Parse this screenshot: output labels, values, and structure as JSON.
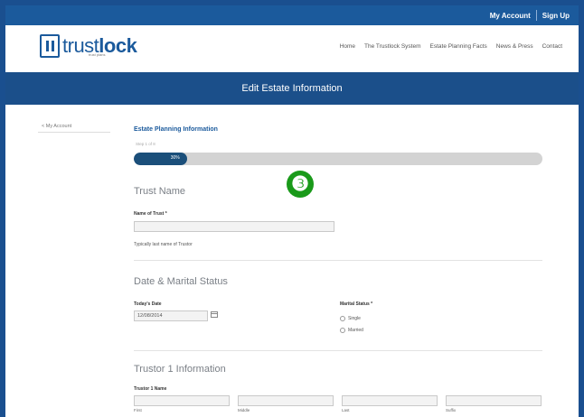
{
  "top_links": {
    "my_account": "My Account",
    "sign_up": "Sign Up"
  },
  "logo": {
    "brand_light": "trust",
    "brand_bold": "lock",
    "tagline": "trust plans"
  },
  "nav": [
    "Home",
    "The Trustlock System",
    "Estate Planning Facts",
    "News & Press",
    "Contact"
  ],
  "banner": {
    "title": "Edit Estate Information"
  },
  "sidebar": {
    "my_account": "< My Account"
  },
  "form": {
    "section_title": "Estate Planning Information",
    "step_label": "Step 1 of 8",
    "progress_text": "30%",
    "progress_fraction": 0.13,
    "step_marker": "❸",
    "trust_name": {
      "heading": "Trust Name",
      "label": "Name of Trust *",
      "value": "",
      "helper": "Typically last name of Trustor"
    },
    "date_marital": {
      "heading": "Date & Marital Status",
      "date_label": "Today's Date",
      "date_value": "12/08/2014",
      "marital_label": "Marital Status *",
      "options": [
        "Single",
        "Married"
      ]
    },
    "trustor1": {
      "heading": "Trustor 1 Information",
      "name_label": "Trustor 1 Name",
      "parts": [
        "First",
        "Middle",
        "Last",
        "Suffix"
      ]
    }
  },
  "colors": {
    "brand": "#1b5a9c",
    "banner": "#1b4f8a",
    "progress": "#1b4f7a",
    "step_marker": "#1a9a1a"
  }
}
